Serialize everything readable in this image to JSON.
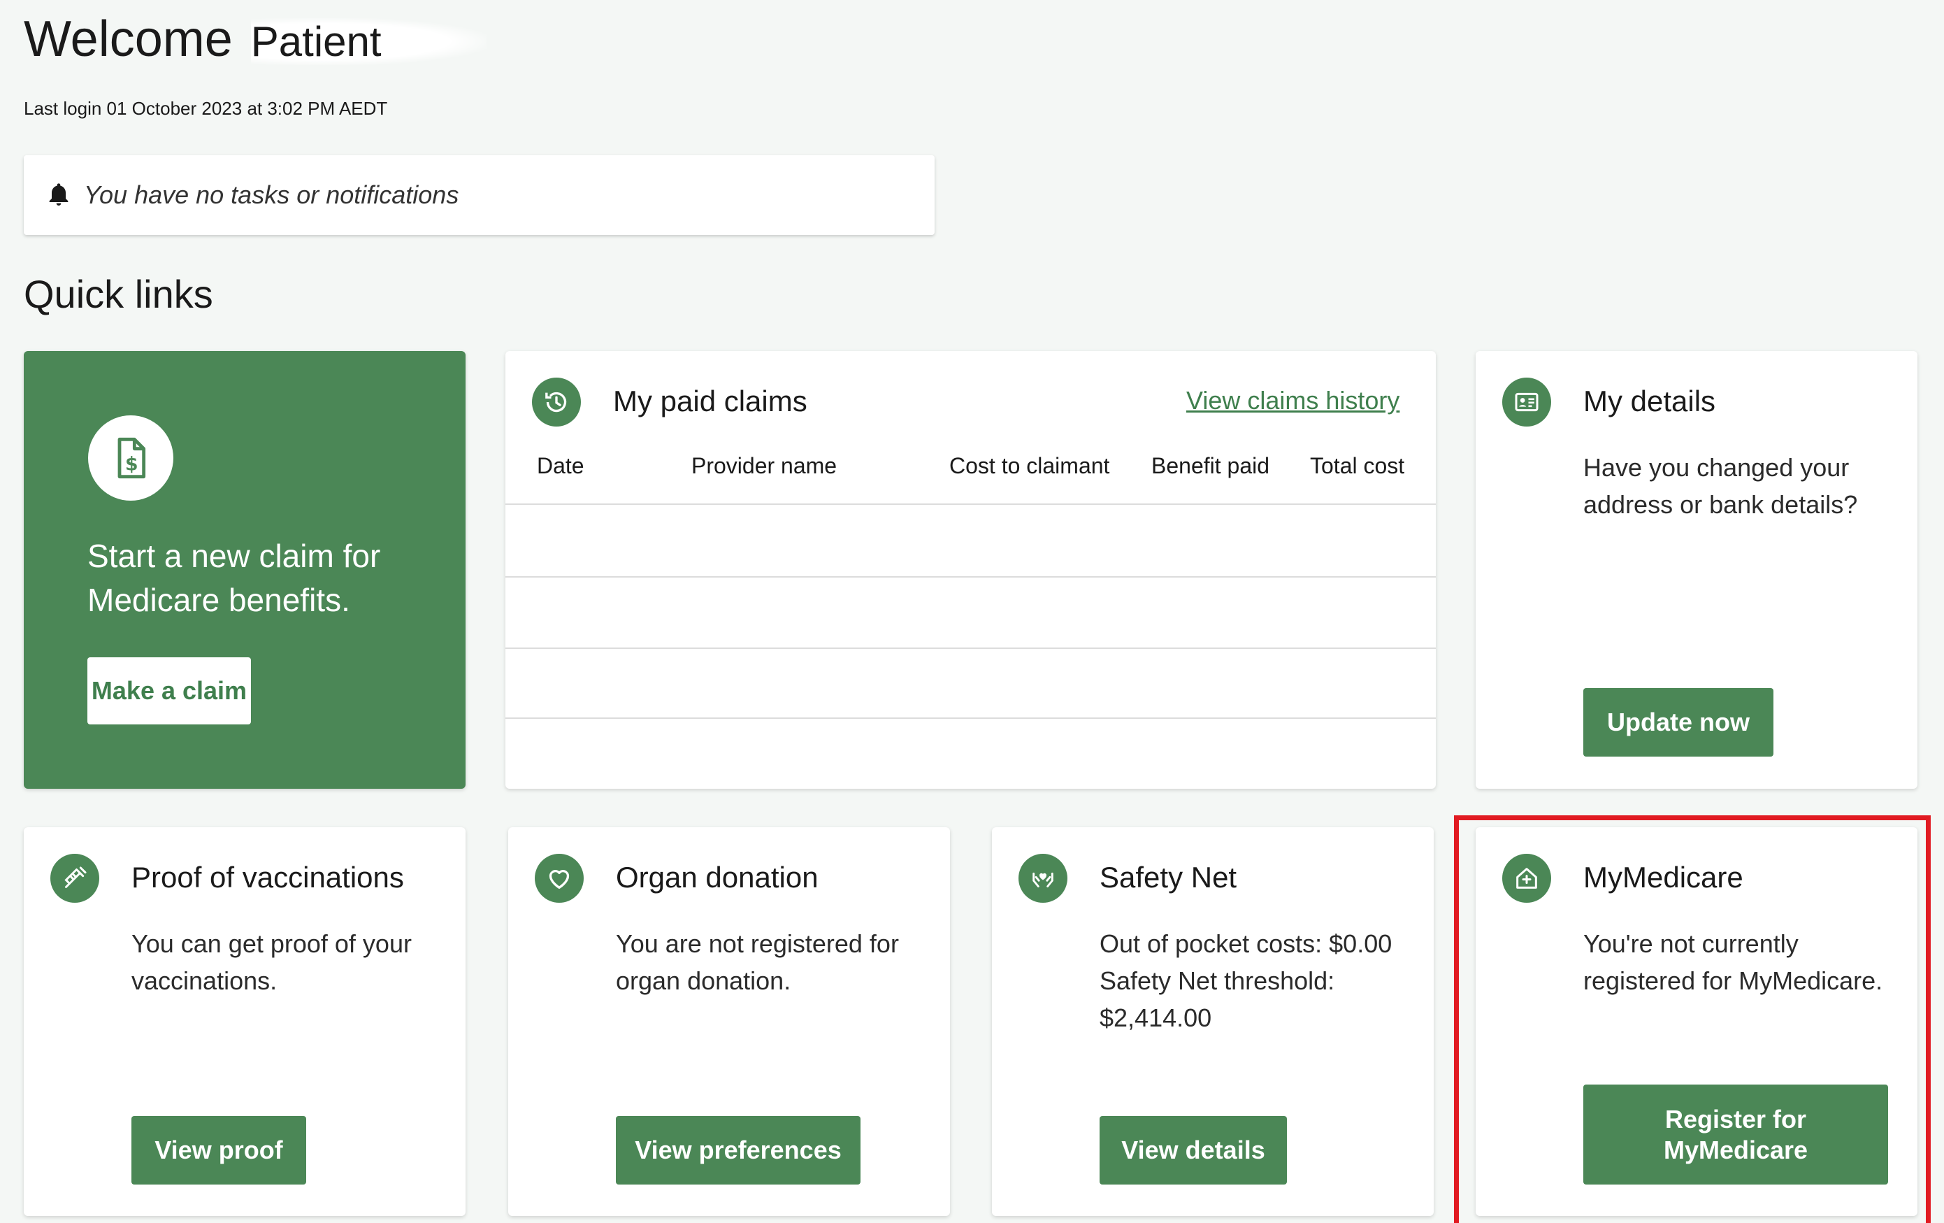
{
  "header": {
    "welcome": "Welcome",
    "name": "Patient",
    "last_login": "Last login 01 October 2023 at 3:02 PM AEDT"
  },
  "notifications": {
    "text": "You have no tasks or notifications",
    "icon": "bell-icon"
  },
  "quick_links": {
    "title": "Quick links"
  },
  "new_claim": {
    "icon": "document-dollar-icon",
    "text": "Start a new claim for Medicare benefits.",
    "button": "Make a claim"
  },
  "paid_claims": {
    "icon": "history-icon",
    "title": "My paid claims",
    "link": "View claims history",
    "columns": [
      "Date",
      "Provider name",
      "Cost to claimant",
      "Benefit paid",
      "Total cost"
    ]
  },
  "my_details": {
    "icon": "id-card-icon",
    "title": "My details",
    "text": "Have you changed your address or bank details?",
    "button": "Update now"
  },
  "vaccinations": {
    "icon": "syringe-icon",
    "title": "Proof of vaccinations",
    "text": "You can get proof of your vaccinations.",
    "button": "View proof"
  },
  "organ_donation": {
    "icon": "heart-icon",
    "title": "Organ donation",
    "text": "You are not registered for organ donation.",
    "button": "View preferences"
  },
  "safety_net": {
    "icon": "hands-heart-icon",
    "title": "Safety Net",
    "line1": "Out of pocket costs: $0.00",
    "line2": "Safety Net threshold:",
    "line3": "$2,414.00",
    "button": "View details"
  },
  "mymedicare": {
    "icon": "house-plus-icon",
    "title": "MyMedicare",
    "text": "You're not currently registered for MyMedicare.",
    "button_line1": "Register for",
    "button_line2": "MyMedicare"
  },
  "colors": {
    "brand_green": "#4b8756",
    "highlight_red": "#e11b22",
    "background": "#f4f7f5"
  }
}
